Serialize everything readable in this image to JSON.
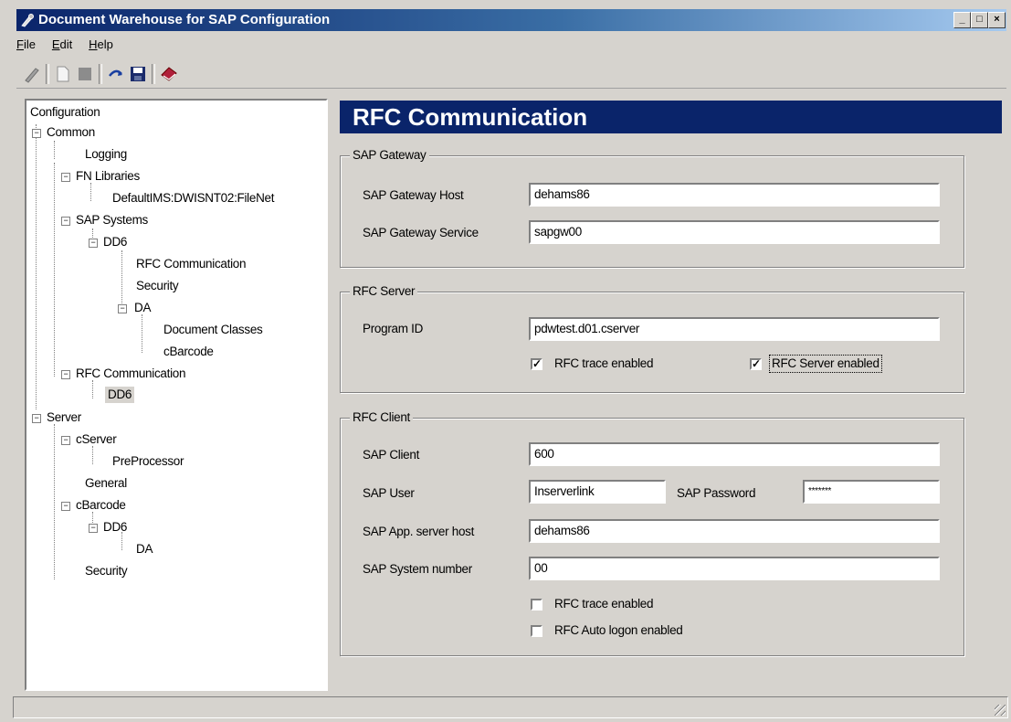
{
  "window": {
    "title": "Document Warehouse for SAP Configuration",
    "controls": {
      "minimize": "_",
      "maximize": "□",
      "close": "×"
    }
  },
  "menu": [
    {
      "label": "File",
      "mnemonic": "F",
      "rest": "ile"
    },
    {
      "label": "Edit",
      "mnemonic": "E",
      "rest": "dit"
    },
    {
      "label": "Help",
      "mnemonic": "H",
      "rest": "elp"
    }
  ],
  "toolbar": {
    "icons": [
      "pencil-icon",
      "new-document-icon",
      "stop-icon",
      "refresh-icon",
      "save-icon",
      "book-icon"
    ]
  },
  "tree": [
    {
      "label": "Configuration"
    },
    {
      "label": "Common"
    },
    {
      "label": "Logging"
    },
    {
      "label": "FN Libraries"
    },
    {
      "label": "DefaultIMS:DWISNT02:FileNet"
    },
    {
      "label": "SAP Systems"
    },
    {
      "label": "DD6"
    },
    {
      "label": "RFC Communication"
    },
    {
      "label": "Security"
    },
    {
      "label": "DA"
    },
    {
      "label": "Document Classes"
    },
    {
      "label": "cBarcode"
    },
    {
      "label": "RFC Communication"
    },
    {
      "label": "DD6"
    },
    {
      "label": "Server"
    },
    {
      "label": "cServer"
    },
    {
      "label": "PreProcessor"
    },
    {
      "label": "General"
    },
    {
      "label": "cBarcode"
    },
    {
      "label": "DD6"
    },
    {
      "label": "DA"
    },
    {
      "label": "Security"
    }
  ],
  "panel": {
    "title": "RFC Communication",
    "gateway": {
      "legend": "SAP Gateway",
      "host_label": "SAP Gateway Host",
      "host_value": "dehams86",
      "service_label": "SAP Gateway Service",
      "service_value": "sapgw00"
    },
    "server": {
      "legend": "RFC Server",
      "program_id_label": "Program ID",
      "program_id_value": "pdwtest.d01.cserver",
      "trace_label": "RFC trace enabled",
      "trace_checked": true,
      "enabled_label": "RFC Server enabled",
      "enabled_checked": true
    },
    "client": {
      "legend": "RFC Client",
      "client_label": "SAP Client",
      "client_value": "600",
      "user_label": "SAP User",
      "user_value": "Inserverlink",
      "password_label": "SAP Password",
      "password_value": "*******",
      "apphost_label": "SAP App. server host",
      "apphost_value": "dehams86",
      "sysnum_label": "SAP System number",
      "sysnum_value": "00",
      "trace_label": "RFC trace enabled",
      "trace_checked": false,
      "autologon_label": "RFC Auto logon enabled",
      "autologon_checked": false
    }
  },
  "check_glyph": "✓",
  "colors": {
    "title_bar": "#0a246a",
    "panel_header": "#0a246a",
    "face": "#d6d3ce"
  }
}
